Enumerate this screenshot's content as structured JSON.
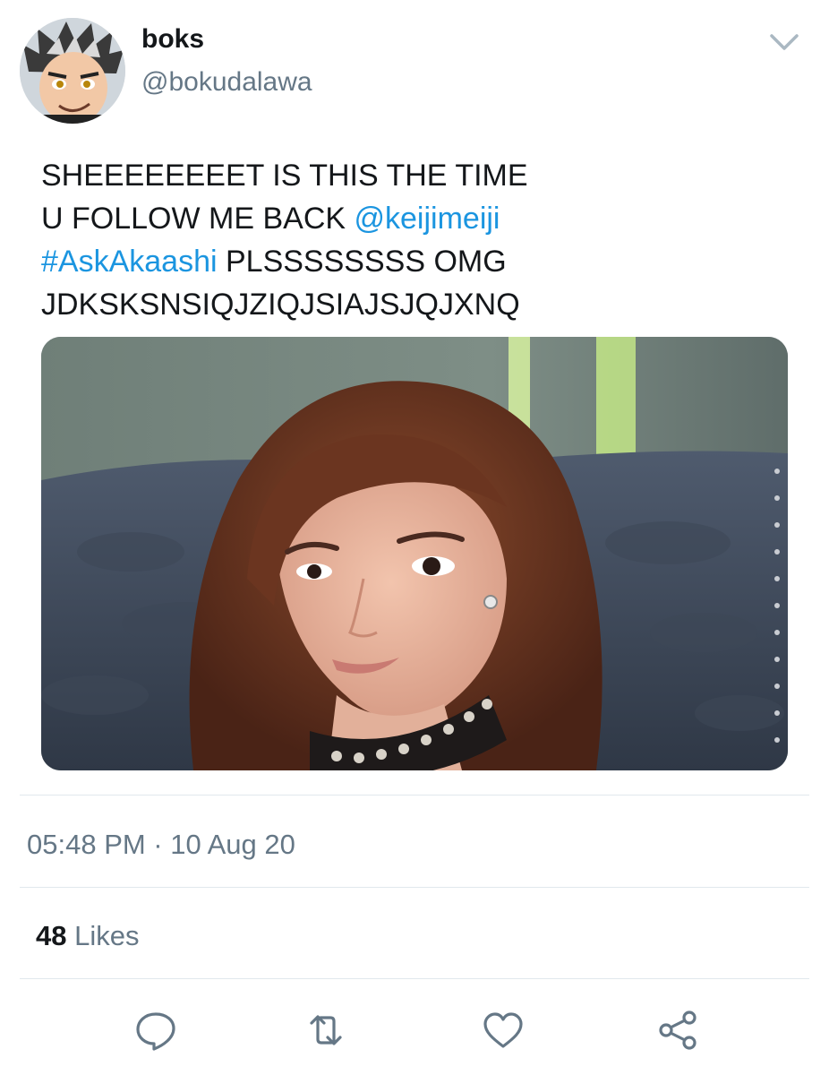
{
  "author": {
    "display_name": "boks",
    "handle": "@bokudalawa",
    "avatar_icon": "anime-avatar"
  },
  "menu_icon": "chevron-down-icon",
  "tweet": {
    "line1": "SHEEEEEEEET IS THIS THE TIME",
    "line2_text": "U FOLLOW ME BACK ",
    "mention": "@keijimeiji",
    "hashtag": "#AskAkaashi",
    "line3_text": " PLSSSSSSSS OMG",
    "line4": "JDKSKSNSIQJZIQJSIAJSJQJXNQ"
  },
  "meta": {
    "timestamp": "05:48 PM · 10 Aug 20",
    "likes_count": "48",
    "likes_label": " Likes"
  },
  "actions": [
    {
      "name": "reply",
      "icon": "comment-icon"
    },
    {
      "name": "retweet",
      "icon": "retweet-icon"
    },
    {
      "name": "like",
      "icon": "heart-icon"
    },
    {
      "name": "share",
      "icon": "share-icon"
    }
  ],
  "colors": {
    "link": "#1b95e0",
    "secondary_text": "#657786",
    "primary_text": "#14171a",
    "divider": "#e1e8ed"
  }
}
